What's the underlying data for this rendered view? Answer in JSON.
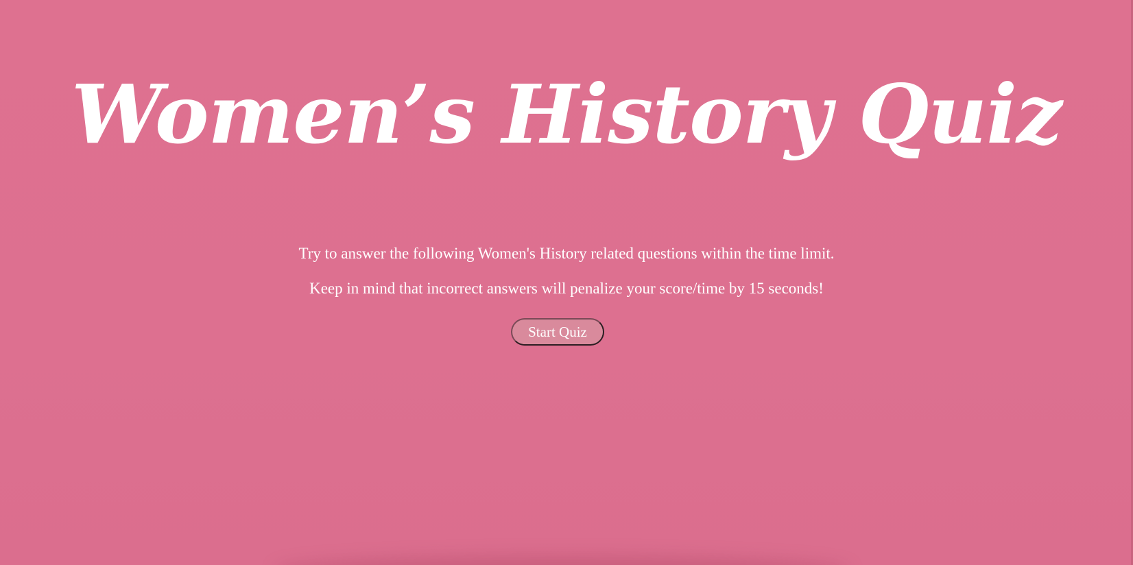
{
  "header": {
    "title": "Women’s History Quiz"
  },
  "intro": {
    "line1": "Try to answer the following Women's History related questions within the time limit.",
    "line2": "Keep in mind that incorrect answers will penalize your score/time by 15 seconds!"
  },
  "actions": {
    "start_label": "Start Quiz"
  },
  "colors": {
    "background": "#de7190",
    "text": "#ffffff",
    "button_fill": "#d98a9c"
  }
}
